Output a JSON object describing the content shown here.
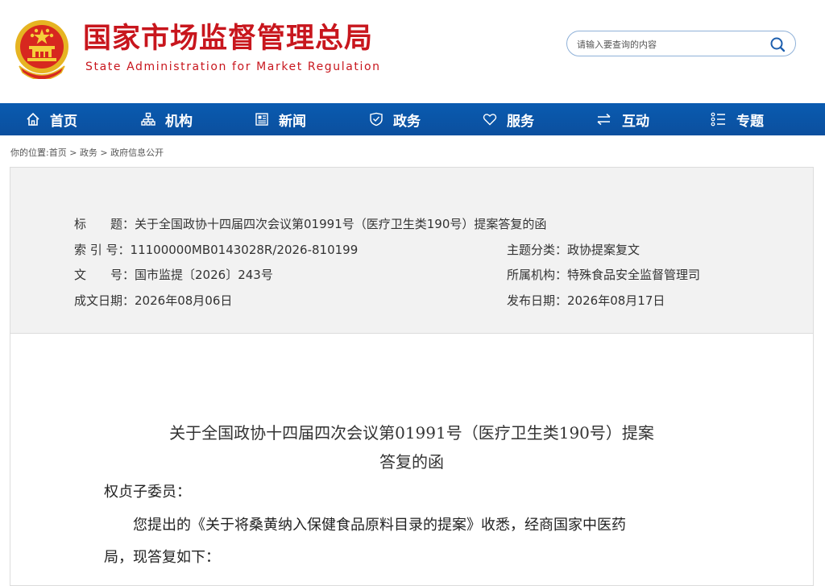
{
  "header": {
    "title_cn": "国家市场监督管理总局",
    "title_en": "State Administration for Market Regulation"
  },
  "search": {
    "placeholder": "请输入要查询的内容",
    "icon": "search-icon"
  },
  "nav": [
    {
      "label": "首页",
      "icon": "home-icon"
    },
    {
      "label": "机构",
      "icon": "org-chart-icon"
    },
    {
      "label": "新闻",
      "icon": "newspaper-icon"
    },
    {
      "label": "政务",
      "icon": "shield-icon"
    },
    {
      "label": "服务",
      "icon": "heart-icon"
    },
    {
      "label": "互动",
      "icon": "swap-arrows-icon"
    },
    {
      "label": "专题",
      "icon": "list-icon"
    }
  ],
  "breadcrumb": {
    "prefix": "你的位置:",
    "items": [
      "首页",
      "政务",
      "政府信息公开"
    ],
    "separator": " > "
  },
  "meta": {
    "title_label": "标　　题：",
    "title_value": "关于全国政协十四届四次会议第01991号（医疗卫生类190号）提案答复的函",
    "index_label": "索 引 号：",
    "index_value": "11100000MB0143028R/2026-810199",
    "topic_label": "主题分类：",
    "topic_value": "政协提案复文",
    "docno_label": "文　　号：",
    "docno_value": "国市监提〔2026〕243号",
    "org_label": "所属机构：",
    "org_value": "特殊食品安全监督管理司",
    "created_label": "成文日期：",
    "created_value": "2026年08月06日",
    "published_label": "发布日期：",
    "published_value": "2026年08月17日"
  },
  "document": {
    "title_line1": "关于全国政协十四届四次会议第01991号（医疗卫生类190号）提案",
    "title_line2": "答复的函",
    "salutation": "权贞子委员：",
    "para1_line1": "您提出的《关于将桑黄纳入保健食品原料目录的提案》收悉，经商国家中医药",
    "para1_line2": "局，现答复如下："
  },
  "colors": {
    "brand_red": "#c8161d",
    "nav_blue": "#0b4f9e",
    "meta_bg": "#f2f2f2"
  }
}
